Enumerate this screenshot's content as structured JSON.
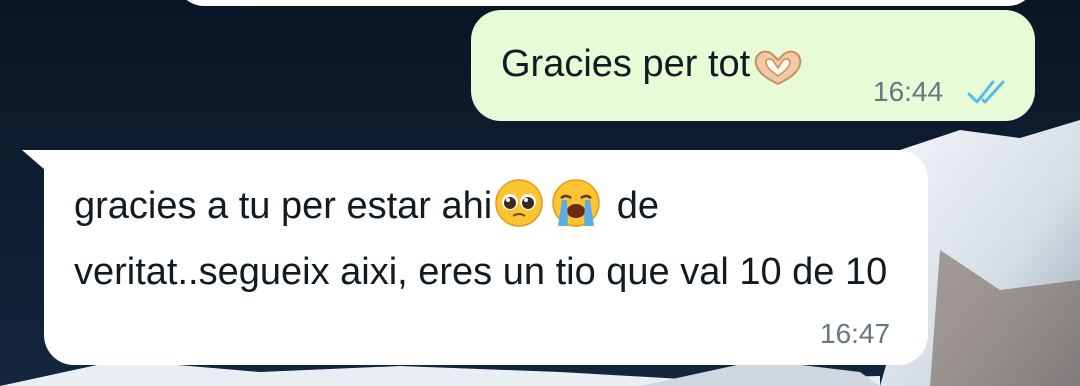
{
  "chat": {
    "outgoing_message": {
      "text": "Gracies per tot",
      "emoji": "heart-hands-icon",
      "time": "16:44",
      "status": "read-double-check-icon"
    },
    "incoming_message": {
      "text_part1": "gracies a tu per estar ahi",
      "emoji1": "pleading-face-icon",
      "emoji2": "loudly-crying-face-icon",
      "text_part2": " de veritat..segueix aixi, eres un tio que val 10 de 10",
      "time": "16:47"
    }
  },
  "colors": {
    "outgoing_bubble": "#e7fcd6",
    "incoming_bubble": "#ffffff",
    "read_ticks": "#53bdeb",
    "time_text": "#667781",
    "message_text": "#111b21"
  }
}
